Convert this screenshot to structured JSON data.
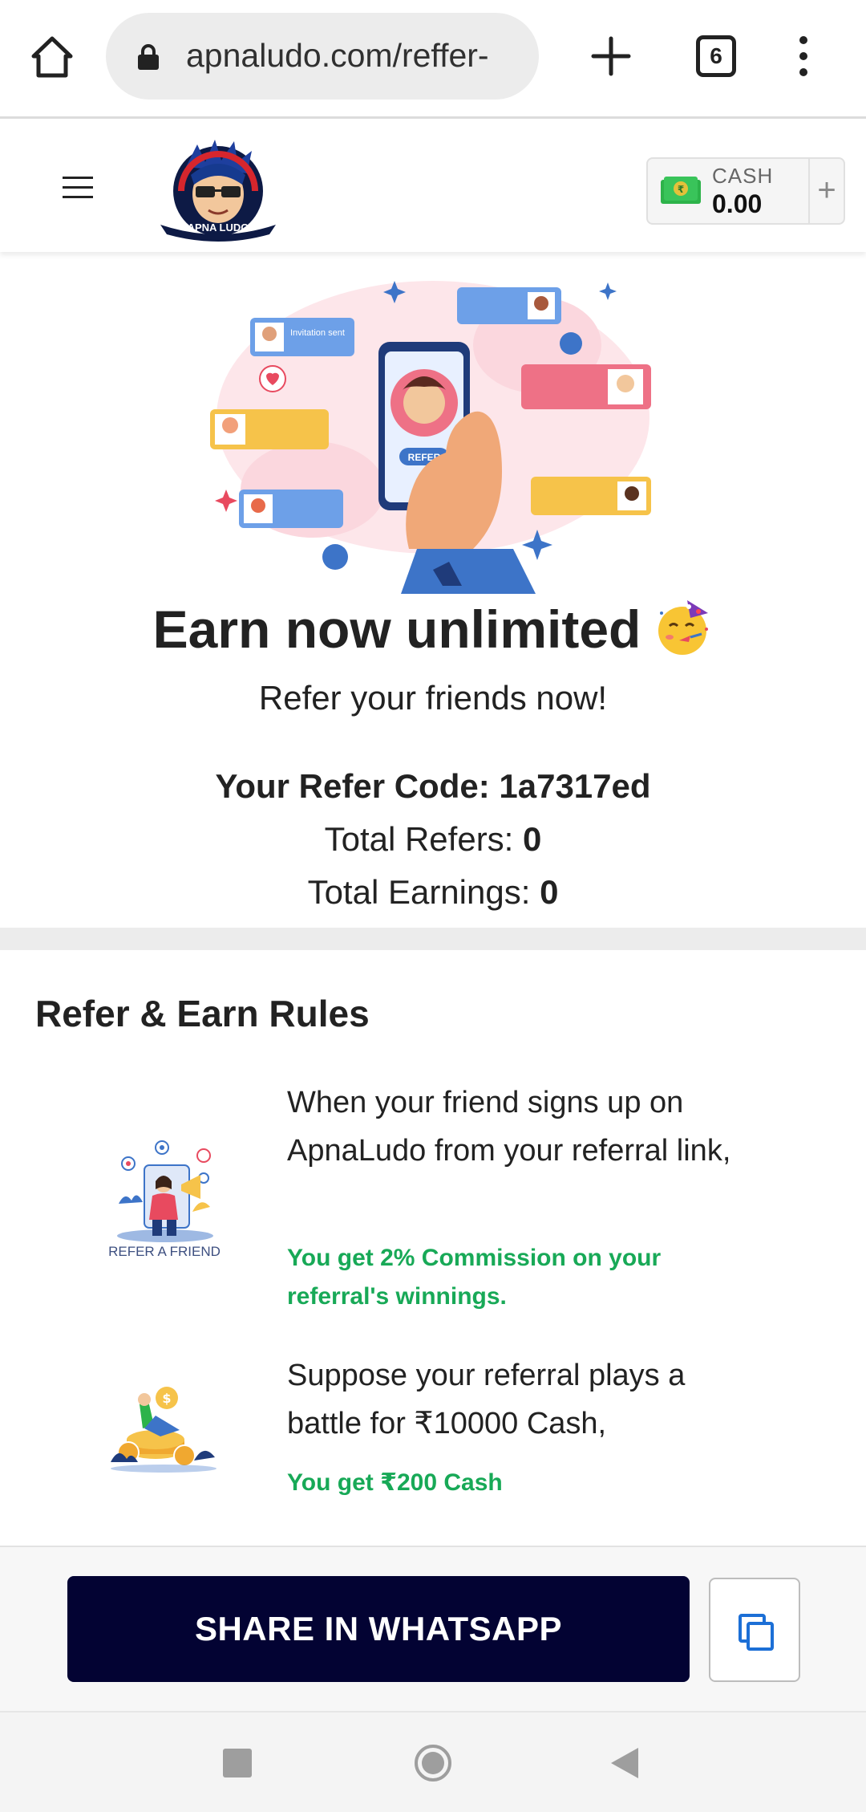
{
  "browser": {
    "url": "apnaludo.com/reffer-",
    "tab_count": "6"
  },
  "header": {
    "logo_text": "APNA LUDO",
    "cash_label": "CASH",
    "cash_value": "0.00",
    "cash_add": "+"
  },
  "hero": {
    "image_labels": [
      "Invitation sent",
      "REFER"
    ],
    "headline": "Earn now unlimited",
    "headline_emoji": "🥳",
    "subhead": "Refer your friends now!"
  },
  "refer": {
    "code_label": "Your Refer Code: ",
    "code_value": "1a7317ed",
    "total_refers_label": "Total Refers: ",
    "total_refers_value": "0",
    "total_earnings_label": "Total Earnings: ",
    "total_earnings_value": "0"
  },
  "rules": {
    "title": "Refer & Earn Rules",
    "items": [
      {
        "illustration_caption": "REFER A FRIEND",
        "text": "When your friend signs up on ApnaLudo from your referral link,",
        "highlight": "You get 2% Commission on your referral's winnings."
      },
      {
        "illustration_caption": "",
        "text": "Suppose your referral plays a battle for ₹10000 Cash,",
        "highlight": "You get ₹200 Cash"
      }
    ]
  },
  "footer": {
    "share_label": "SHARE IN WHATSAPP"
  },
  "colors": {
    "share_button": "#030333",
    "highlight_green": "#18a957",
    "cash_green": "#2db34a"
  }
}
